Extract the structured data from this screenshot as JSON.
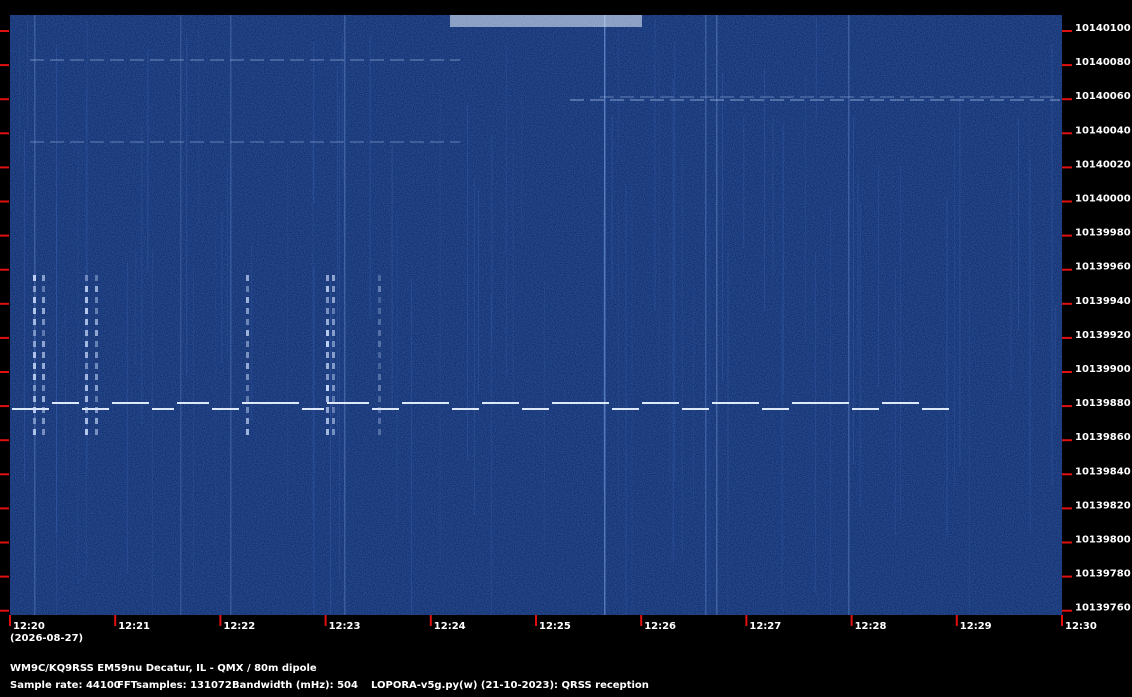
{
  "colors": {
    "waterfall_background": "#0a2260",
    "tick_marks": "#e01010",
    "signal_trace": "#e8f2ff",
    "text": "#ffffff"
  },
  "frequency_axis": {
    "labels": [
      "10140100",
      "10140080",
      "10140060",
      "10140040",
      "10140020",
      "10140000",
      "10139980",
      "10139960",
      "10139940",
      "10139920",
      "10139900",
      "10139880",
      "10139860",
      "10139840",
      "10139820",
      "10139800",
      "10139780",
      "10139760"
    ]
  },
  "time_axis": {
    "labels": [
      "12:20",
      "12:21",
      "12:22",
      "12:23",
      "12:24",
      "12:25",
      "12:26",
      "12:27",
      "12:28",
      "12:29",
      "12:30"
    ],
    "date": "(2026-08-27)"
  },
  "footer": {
    "station": "WM9C/KQ9RSS EM59nu Decatur, IL - QMX / 80m dipole",
    "sample_rate": "Sample rate: 44100",
    "fft_samples": "FFTsamples: 131072",
    "bandwidth": "Bandwidth (mHz): 504",
    "software": "LOPORA-v5g.py(w) (21-10-2023): QRSS reception"
  }
}
